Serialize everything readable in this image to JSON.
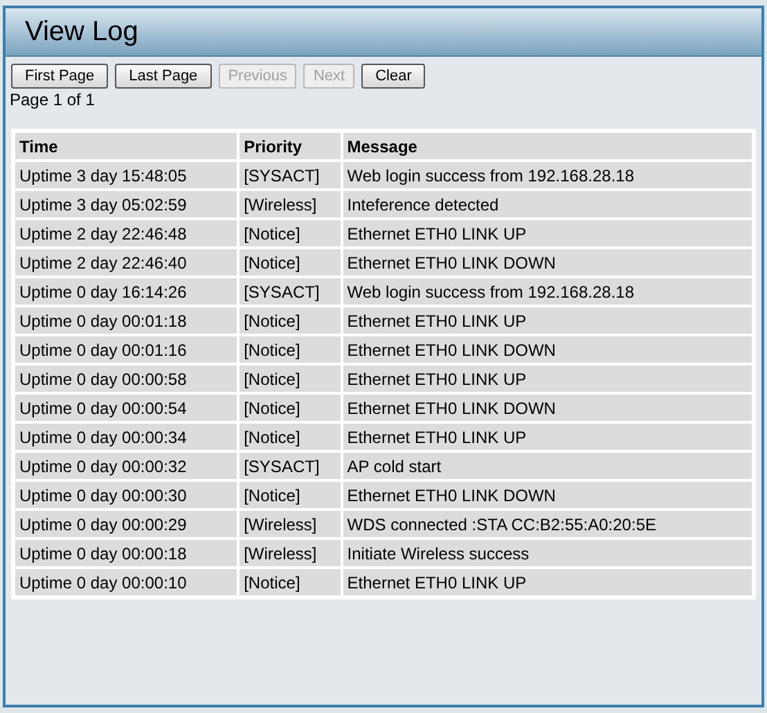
{
  "title": "View Log",
  "buttons": [
    {
      "label": "First Page",
      "disabled": false
    },
    {
      "label": "Last Page",
      "disabled": false
    },
    {
      "label": "Previous",
      "disabled": true
    },
    {
      "label": "Next",
      "disabled": true
    },
    {
      "label": "Clear",
      "disabled": false
    }
  ],
  "page_info": "Page 1 of 1",
  "table": {
    "columns": [
      "Time",
      "Priority",
      "Message"
    ],
    "rows": [
      [
        "Uptime 3 day 15:48:05",
        "[SYSACT]",
        "Web login success from 192.168.28.18"
      ],
      [
        "Uptime 3 day 05:02:59",
        "[Wireless]",
        "Inteference detected"
      ],
      [
        "Uptime 2 day 22:46:48",
        "[Notice]",
        "Ethernet ETH0 LINK UP"
      ],
      [
        "Uptime 2 day 22:46:40",
        "[Notice]",
        "Ethernet ETH0 LINK DOWN"
      ],
      [
        "Uptime 0 day 16:14:26",
        "[SYSACT]",
        "Web login success from 192.168.28.18"
      ],
      [
        "Uptime 0 day 00:01:18",
        "[Notice]",
        "Ethernet ETH0 LINK UP"
      ],
      [
        "Uptime 0 day 00:01:16",
        "[Notice]",
        "Ethernet ETH0 LINK DOWN"
      ],
      [
        "Uptime 0 day 00:00:58",
        "[Notice]",
        "Ethernet ETH0 LINK UP"
      ],
      [
        "Uptime 0 day 00:00:54",
        "[Notice]",
        "Ethernet ETH0 LINK DOWN"
      ],
      [
        "Uptime 0 day 00:00:34",
        "[Notice]",
        "Ethernet ETH0 LINK UP"
      ],
      [
        "Uptime 0 day 00:00:32",
        "[SYSACT]",
        "AP cold start"
      ],
      [
        "Uptime 0 day 00:00:30",
        "[Notice]",
        "Ethernet ETH0 LINK DOWN"
      ],
      [
        "Uptime 0 day 00:00:29",
        "[Wireless]",
        "WDS connected :STA CC:B2:55:A0:20:5E"
      ],
      [
        "Uptime 0 day 00:00:18",
        "[Wireless]",
        "Initiate Wireless success"
      ],
      [
        "Uptime 0 day 00:00:10",
        "[Notice]",
        "Ethernet ETH0 LINK UP"
      ]
    ]
  }
}
